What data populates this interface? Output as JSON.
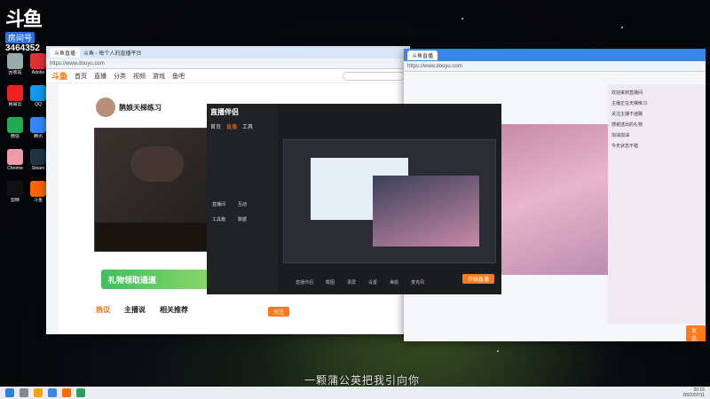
{
  "overlay": {
    "logo_text": "斗鱼",
    "room_label": "房间号",
    "room_number": "3464352",
    "subtitle": "一颗蒲公英把我引向你"
  },
  "browser_left": {
    "title": "斗鱼 - 每个人的直播平台",
    "tab": "斗鱼直播",
    "url": "https://www.douyu.com",
    "nav": [
      "首页",
      "直播",
      "分类",
      "视频",
      "游戏",
      "鱼吧"
    ],
    "streamer_name": "鹊娘天梯练习",
    "banner_text": "礼物领取通道",
    "bottom_tabs": [
      "热议",
      "主播说",
      "相关推荐"
    ],
    "follow_btn": "关注"
  },
  "obs": {
    "brand": "直播伴侣",
    "menu": [
      "首页",
      "直播",
      "工具"
    ],
    "items": [
      "直播间",
      "互动",
      "工具箱",
      "数据"
    ],
    "bottom_items": [
      "直播伴侣",
      "截图",
      "录屏",
      "设置",
      "美颜",
      "麦克风"
    ],
    "start_btn": "开始直播"
  },
  "browser_right": {
    "tab": "斗鱼直播",
    "url": "https://www.douyu.com",
    "chat_lines": [
      "欢迎来到直播间",
      "主播正在天梯练习",
      "关注主播不迷路",
      "感谢送出的礼物",
      "加油加油",
      "今天状态不错"
    ],
    "send_btn": "发送"
  },
  "taskbar": {
    "time": "20:15",
    "date": "2022/07/11"
  },
  "desktop_icons": [
    "回收站",
    "Adobe",
    "网易云",
    "QQ",
    "微信",
    "腾讯",
    "Chrome",
    "Steam",
    "剪映",
    "斗鱼"
  ]
}
